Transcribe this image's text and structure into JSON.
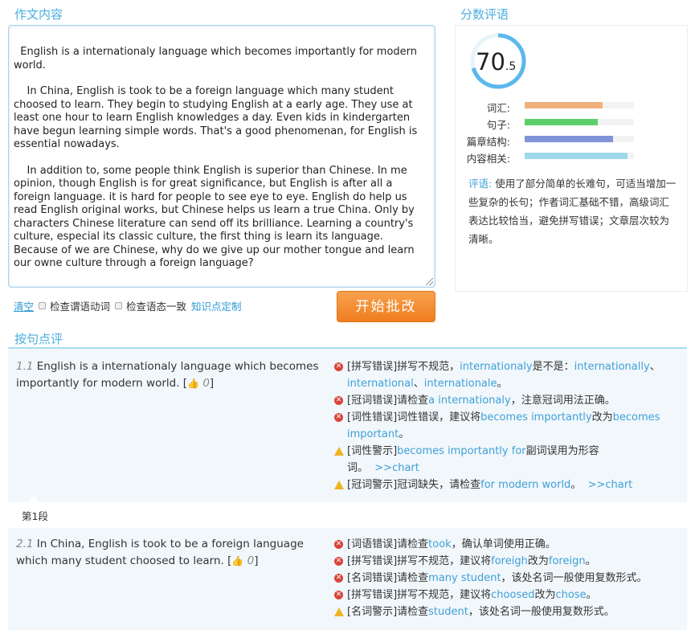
{
  "sections": {
    "essay_title": "作文内容",
    "score_title": "分数评语",
    "review_title": "按句点评"
  },
  "essay": {
    "paragraphs": [
      "  English is a internationaly language which becomes importantly for modern world.",
      "    In China, English is took to be a foreign language which many student choosed to learn. They begin to studying English at a early age. They use at least one hour to learn English knowledges a day. Even kids in kindergarten have begun learning simple words. That's a good phenomenan, for English is essential nowadays.",
      "    In addition to, some people think English is superior than Chinese. In me opinion, though English is for great significance, but English is after all a foreign language. it is hard for people to see eye to eye. English do help us read English original works, but Chinese helps us learn a true China. Only by characters Chinese literature can send off its brilliance. Learning a country's culture, especial its classic culture, the first thing is learn its language. Because of we are Chinese, why do we give up our mother tongue and learn our owne culture through a foreign language?"
    ]
  },
  "score": {
    "integer": "70",
    "decimal": ".5",
    "value": 70.5,
    "ring_color": "#5bb8ec",
    "metrics": [
      {
        "label": "词汇:",
        "value": 0.71,
        "color": "#f0b07a"
      },
      {
        "label": "句子:",
        "value": 0.67,
        "color": "#5ccf6a"
      },
      {
        "label": "篇章结构:",
        "value": 0.81,
        "color": "#7f93d6"
      },
      {
        "label": "内容相关:",
        "value": 0.94,
        "color": "#9fd8ea"
      }
    ],
    "comment_label": "评语:",
    "comment_text": "  使用了部分简单的长难句，可适当增加一些复杂的长句；作者词汇基础不错，高级词汇表达比较恰当，避免拼写错误；文章层次较为清晰。"
  },
  "controls": {
    "clear": "清空",
    "check1": "检查谓语动词",
    "check2": "检查语态一致",
    "custom": "知识点定制",
    "start": "开始批改"
  },
  "review": {
    "s1": {
      "num": "1.1",
      "text": "English is a internationaly language which becomes importantly for modern world.",
      "likes": "0",
      "issues": {
        "a_tag": "[拼写错误]拼写不规范，",
        "a_hl1": "internationaly",
        "a_mid": "是不是：",
        "a_hl2": "internationally",
        "a_sep": "、",
        "a_hl3": "international",
        "a_sep2": "、",
        "a_hl4": "internationale",
        "a_end": "。",
        "b_tag": "[冠词错误]请检查",
        "b_hl": "a internationaly",
        "b_end": "，注意冠词用法正确。",
        "c_tag": "[词性错误]词性错误，建议将",
        "c_hl1": "becomes importantly",
        "c_mid": "改为",
        "c_hl2": "becomes important",
        "c_end": "。",
        "d_tag": "[词性警示]",
        "d_hl": "becomes importantly for",
        "d_mid": "副词误用为形容",
        "d_end": "词。",
        "d_chart": ">>chart",
        "e_tag": "[冠词警示]冠词缺失，请检查",
        "e_hl": "for modern world",
        "e_end": "。",
        "e_chart": ">>chart"
      }
    },
    "paragraph_label": "第1段",
    "s2": {
      "num": "2.1",
      "text": "In China, English is took to be a foreign language which many student choosed to learn.",
      "likes": "0",
      "issues": {
        "a_tag": "[词语错误]请检查",
        "a_hl": "took",
        "a_end": "，确认单词使用正确。",
        "b_tag": "[拼写错误]拼写不规范，建议将",
        "b_hl1": "foreigh",
        "b_mid": "改为",
        "b_hl2": "foreign",
        "b_end": "。",
        "c_tag": "[名词错误]请检查",
        "c_hl": "many student",
        "c_end": "，该处名词一般使用复数形式。",
        "d_tag": "[拼写错误]拼写不规范，建议将",
        "d_hl1": "choosed",
        "d_mid": "改为",
        "d_hl2": "chose",
        "d_end": "。",
        "e_tag": "[名词警示]请检查",
        "e_hl": "student",
        "e_end": "，该处名词一般使用复数形式。"
      }
    }
  }
}
